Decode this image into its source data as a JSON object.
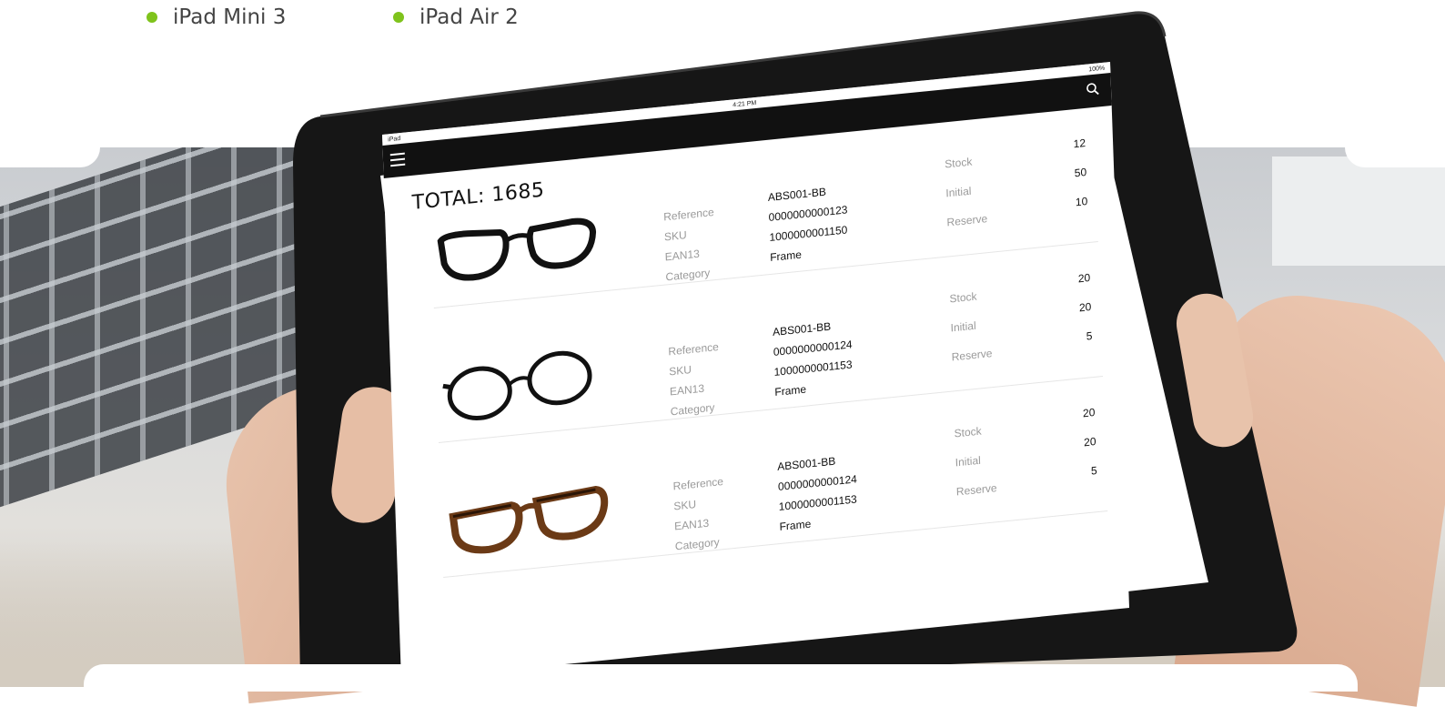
{
  "bullets": [
    {
      "label": "iPad Mini 3"
    },
    {
      "label": "iPad Air 2"
    }
  ],
  "status_bar": {
    "carrier": "iPad",
    "time": "4:21 PM",
    "battery": "100%"
  },
  "app": {
    "total_label": "TOTAL: 1685"
  },
  "field_labels": {
    "reference": "Reference",
    "sku": "SKU",
    "ean13": "EAN13",
    "category": "Category",
    "stock": "Stock",
    "initial": "Initial",
    "reserve": "Reserve"
  },
  "products": [
    {
      "reference": "ABS001-BB",
      "sku": "0000000000123",
      "ean13": "1000000001150",
      "category": "Frame",
      "stock": "12",
      "initial": "50",
      "reserve": "10",
      "style": "black-rectangular"
    },
    {
      "reference": "ABS001-BB",
      "sku": "0000000000124",
      "ean13": "1000000001153",
      "category": "Frame",
      "stock": "20",
      "initial": "20",
      "reserve": "5",
      "style": "black-round"
    },
    {
      "reference": "ABS001-BB",
      "sku": "0000000000124",
      "ean13": "1000000001153",
      "category": "Frame",
      "stock": "20",
      "initial": "20",
      "reserve": "5",
      "style": "tortoise-square"
    }
  ],
  "colors": {
    "bullet": "#7fc31c",
    "app_bar": "#111111",
    "tablet_frame": "#161616"
  }
}
